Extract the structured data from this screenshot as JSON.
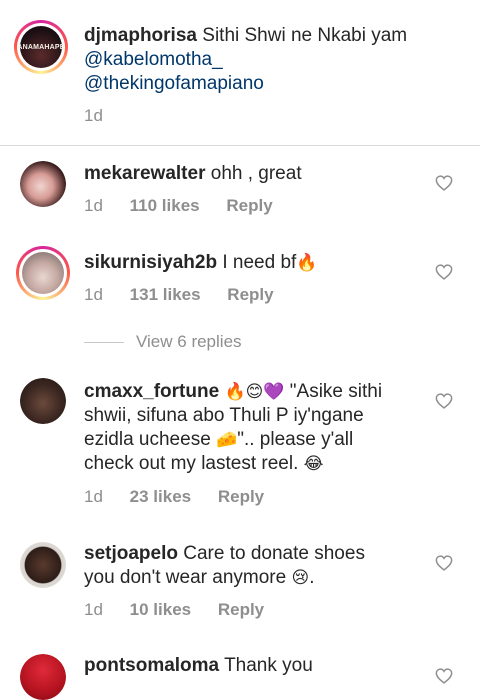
{
  "caption": {
    "username": "djmaphorisa",
    "text": "Sithi Shwi ne Nkabi yam",
    "mention1": "@kabelomotha_",
    "mention2": "@thekingofamapiano",
    "time": "1d",
    "avatar_label": "ANAMAHAPE"
  },
  "comments": [
    {
      "username": "mekarewalter",
      "text": "ohh , great",
      "time": "1d",
      "likes": "110 likes",
      "reply": "Reply"
    },
    {
      "username": "sikurnisiyah2b",
      "text": "I need bf",
      "emoji": "🔥",
      "time": "1d",
      "likes": "131 likes",
      "reply": "Reply"
    },
    {
      "username": "cmaxx_fortune",
      "line1_text": "\"Asike sithi",
      "emojis": "🔥😊💜",
      "line2": "shwii, sifuna abo Thuli P iy'ngane",
      "line3_text": "ezidla ucheese",
      "line3_emoji": "🧀",
      "line3_tail": "\".. please y'all",
      "line4_text": "check out my lastest reel.",
      "line4_emoji": "😂",
      "time": "1d",
      "likes": "23 likes",
      "reply": "Reply"
    },
    {
      "username": "setjoapelo",
      "line1_text": "Care to donate shoes",
      "line2_text": "you don't wear anymore",
      "line2_emoji": "😢",
      "line2_tail": ".",
      "time": "1d",
      "likes": "10 likes",
      "reply": "Reply"
    },
    {
      "username": "pontsomaloma",
      "text": "Thank you"
    }
  ],
  "view_replies": "View 6 replies",
  "colors": {
    "text": "#262626",
    "meta": "#8e8e8e",
    "mention": "#00376b",
    "heart": "#8e8e8e"
  }
}
